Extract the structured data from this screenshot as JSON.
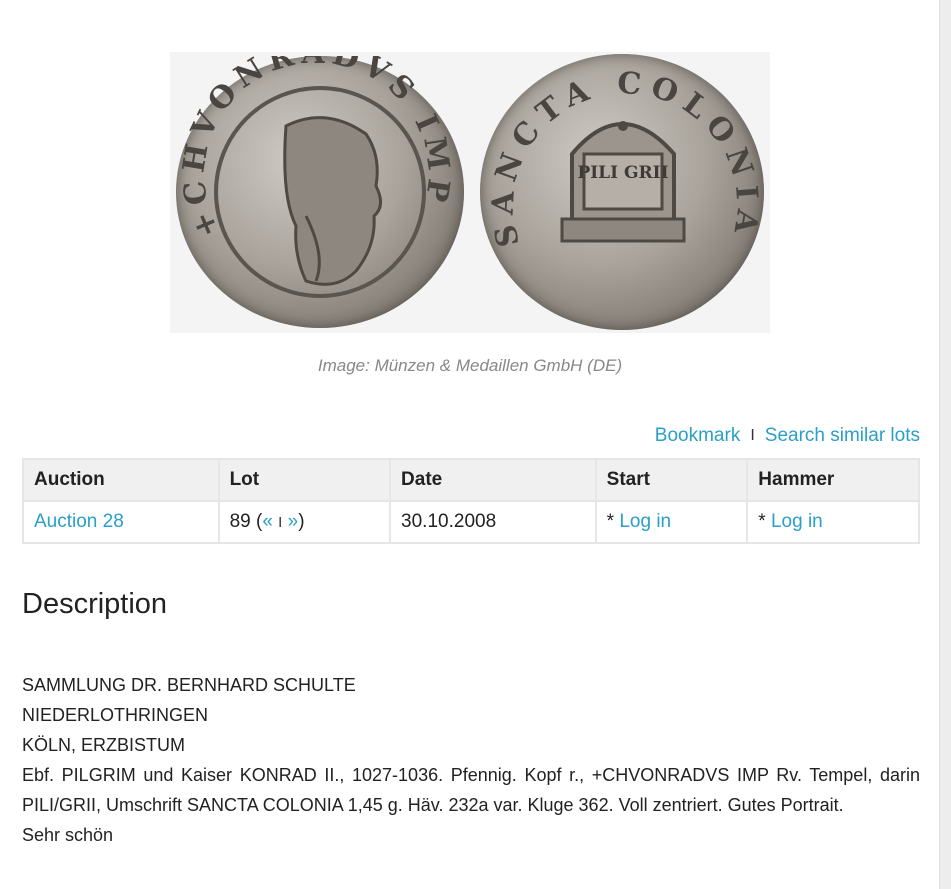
{
  "image": {
    "caption": "Image: Münzen & Medaillen GmbH (DE)",
    "obverse_legend": "+CHVONRADVS IMP",
    "reverse_inscription": "PILI GRII",
    "reverse_legend": "SANCTA COLONIA"
  },
  "actions": {
    "bookmark": "Bookmark",
    "separator": "I",
    "search_similar": "Search similar lots"
  },
  "lot_table": {
    "headers": [
      "Auction",
      "Lot",
      "Date",
      "Start",
      "Hammer"
    ],
    "row": {
      "auction": "Auction 28",
      "lot_number": "89",
      "lot_prefix": "(",
      "prev": "«",
      "nav_sep": "I",
      "next": "»",
      "lot_suffix": ")",
      "date": "30.10.2008",
      "start_prefix": "* ",
      "start_login": "Log in",
      "hammer_prefix": "* ",
      "hammer_login": "Log in"
    }
  },
  "description": {
    "title": "Description",
    "lines": [
      "SAMMLUNG DR. BERNHARD SCHULTE",
      "NIEDERLOTHRINGEN",
      "KÖLN, ERZBISTUM",
      "Ebf. PILGRIM und Kaiser KONRAD II., 1027-1036. Pfennig. Kopf r., +CHVONRADVS IMP Rv. Tempel, darin PILI/GRII, Umschrift SANCTA COLONIA 1,45 g. Häv. 232a var. Kluge 362. Voll zentriert. Gutes Portrait.",
      "Sehr schön"
    ]
  },
  "colors": {
    "link": "#2a9fc9",
    "caption": "#888888",
    "table_header_bg": "#f0f0f0",
    "table_border": "#e6e6e6"
  }
}
